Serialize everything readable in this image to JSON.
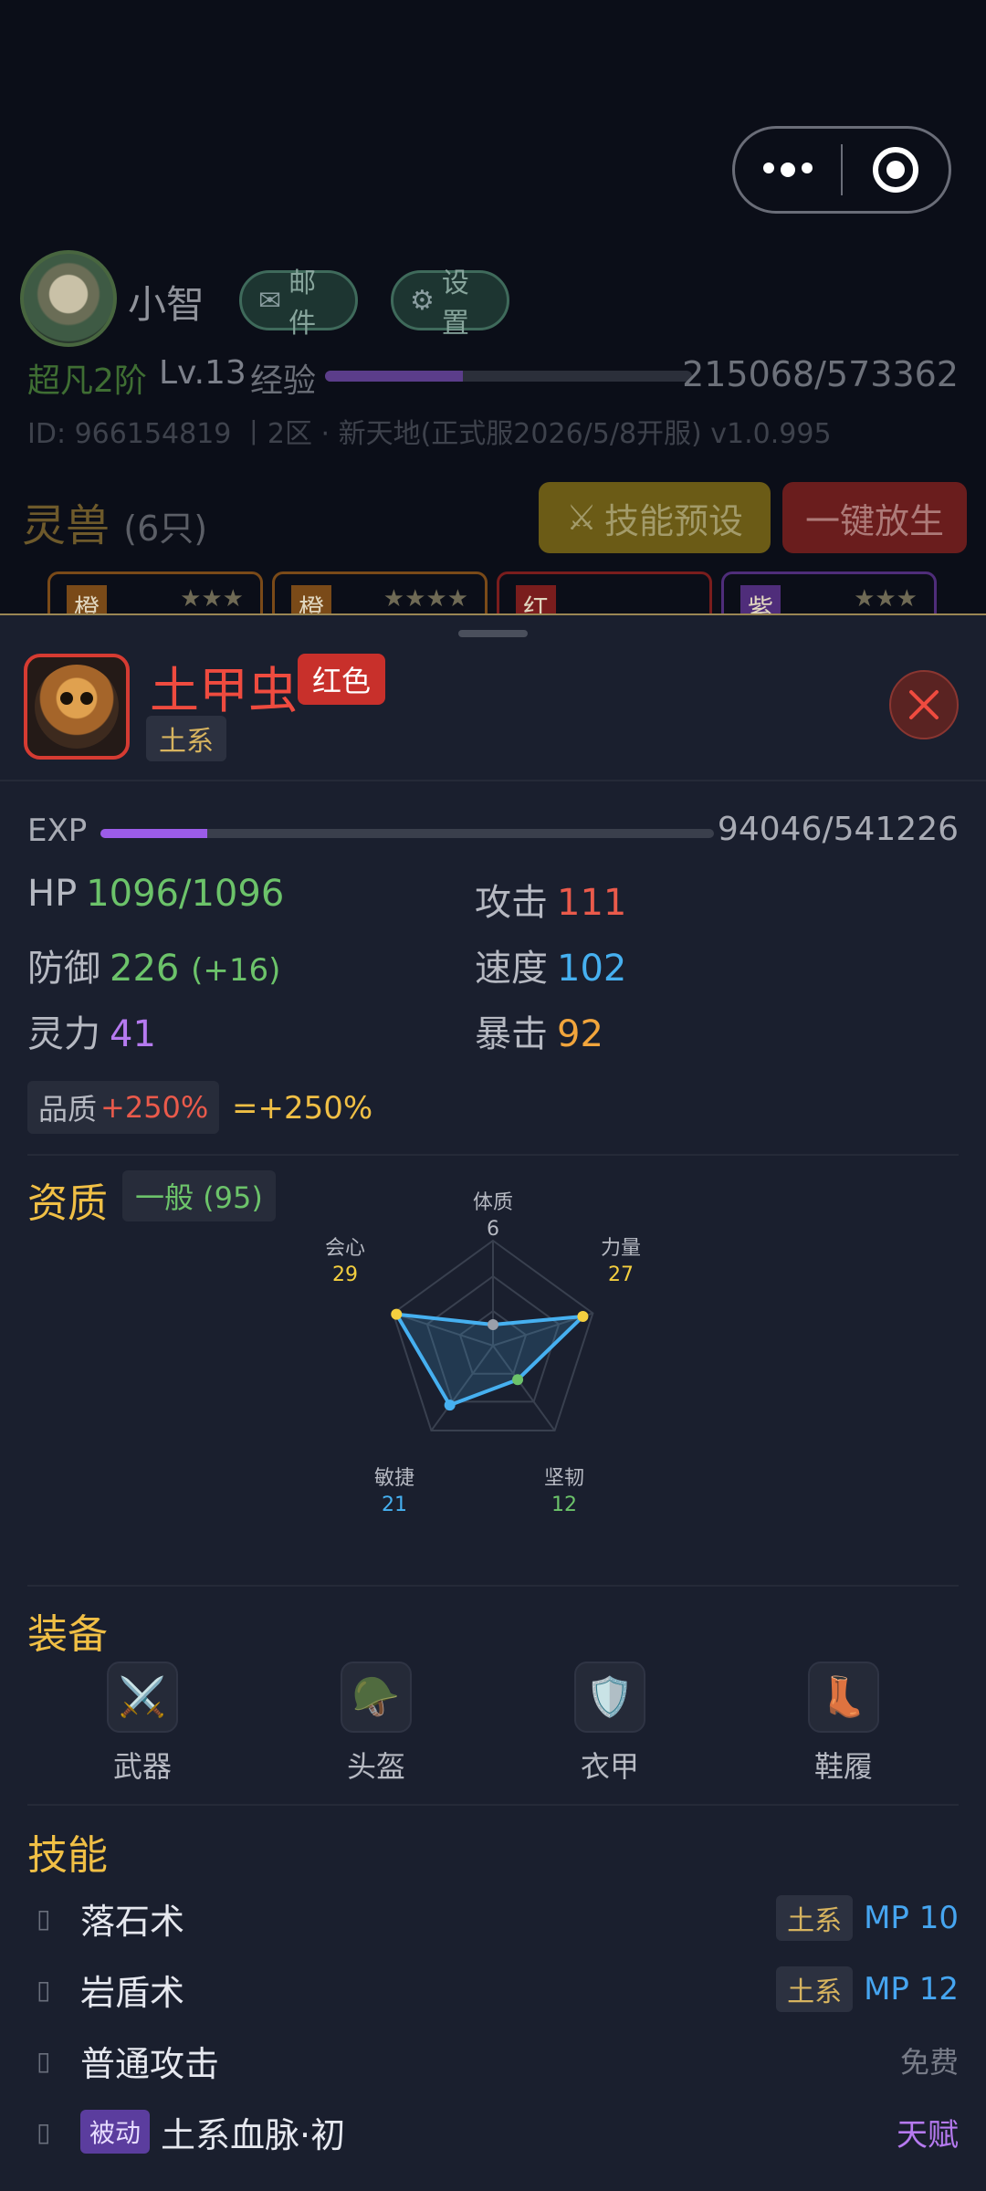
{
  "player": {
    "name": "小智",
    "mail_label": "邮件",
    "settings_label": "设置",
    "rank": "超凡2阶",
    "level": "Lv.13",
    "exp_label": "经验",
    "exp_value": "215068/573362",
    "exp_progress": 0.375,
    "id_line": "ID: 966154819 丨2区 · 新天地(正式服2026/5/8开服)  v1.0.995"
  },
  "pets_section": {
    "title": "灵兽",
    "count": "(6只)",
    "skill_preset_label": "技能预设",
    "release_label": "一键放生",
    "cards": [
      {
        "tag": "橙",
        "stars": "★★★",
        "color": "#7a4a18"
      },
      {
        "tag": "橙",
        "stars": "★★★★",
        "color": "#7a4a18"
      },
      {
        "tag": "红",
        "stars": "",
        "color": "#7a1d1d"
      },
      {
        "tag": "紫",
        "stars": "★★★",
        "color": "#4f2d7a"
      }
    ]
  },
  "pet": {
    "name": "土甲虫",
    "quality": "红色",
    "element": "土系",
    "exp_label": "EXP",
    "exp_value": "94046/541226",
    "exp_progress": 0.174,
    "stats": {
      "hp_label": "HP",
      "hp_value": "1096/1096",
      "atk_label": "攻击",
      "atk_value": "111",
      "def_label": "防御",
      "def_value": "226",
      "def_bonus": "(+16)",
      "spd_label": "速度",
      "spd_value": "102",
      "spirit_label": "灵力",
      "spirit_value": "41",
      "crit_label": "暴击",
      "crit_value": "92"
    },
    "quality_label": "品质",
    "quality_bonus": "+250%",
    "quality_total": "=+250%"
  },
  "aptitude": {
    "title": "资质",
    "grade": "一般 (95)",
    "radar": [
      {
        "label": "体质",
        "value": "6"
      },
      {
        "label": "力量",
        "value": "27"
      },
      {
        "label": "坚韧",
        "value": "12"
      },
      {
        "label": "敏捷",
        "value": "21"
      },
      {
        "label": "会心",
        "value": "29"
      }
    ],
    "radar_max": 30
  },
  "equipment": {
    "title": "装备",
    "slots": [
      {
        "label": "武器",
        "icon": "⚔️"
      },
      {
        "label": "头盔",
        "icon": "🪖"
      },
      {
        "label": "衣甲",
        "icon": "🛡️"
      },
      {
        "label": "鞋履",
        "icon": "👢"
      }
    ]
  },
  "skills": {
    "title": "技能",
    "list": [
      {
        "name": "落石术",
        "element": "土系",
        "cost": "MP 10"
      },
      {
        "name": "岩盾术",
        "element": "土系",
        "cost": "MP 12"
      },
      {
        "name": "普通攻击",
        "cost": "免费"
      },
      {
        "name": "土系血脉·初",
        "passive": "被动",
        "cost": "天赋"
      }
    ]
  },
  "colors": {
    "accent_gold": "#f0bf45",
    "quality_red": "#c8302b",
    "exp_purple": "#9b5ce8",
    "radar_line": "#46b0f0"
  }
}
